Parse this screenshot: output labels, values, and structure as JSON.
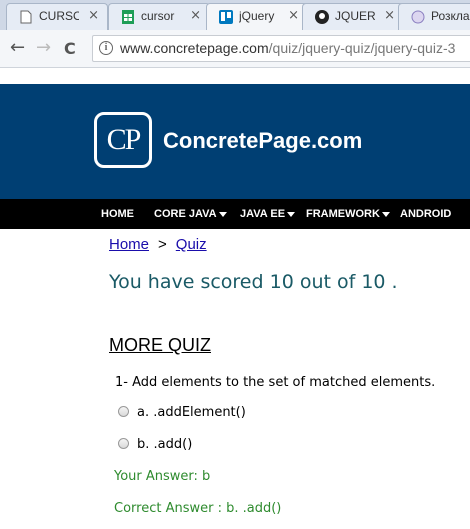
{
  "browser": {
    "tabs": [
      {
        "label": "CURSO",
        "icon": "document-icon",
        "close": "×"
      },
      {
        "label": "cursor",
        "icon": "sheets-icon",
        "close": "×"
      },
      {
        "label": "jQuery",
        "icon": "trello-icon",
        "close": "×"
      },
      {
        "label": "JQUER",
        "icon": "github-icon",
        "close": "×"
      },
      {
        "label": "Розкла",
        "icon": "tab-favicon-icon",
        "close": ""
      }
    ],
    "back": "←",
    "forward": "→",
    "reload": "C",
    "info": "i",
    "url_host": "www.concretepage.com",
    "url_path": "/quiz/jquery-quiz/jquery-quiz-3"
  },
  "site": {
    "logo_mark": "CP",
    "logo_text": "ConcretePage.com",
    "menu": [
      {
        "label": "HOME",
        "caret": false
      },
      {
        "label": "CORE JAVA",
        "caret": true
      },
      {
        "label": "JAVA EE",
        "caret": true
      },
      {
        "label": "FRAMEWORK",
        "caret": true
      },
      {
        "label": "ANDROID",
        "caret": false
      }
    ]
  },
  "content": {
    "breadcrumb_home": "Home",
    "breadcrumb_sep": ">",
    "breadcrumb_quiz": "Quiz",
    "score_text": "You have scored 10 out of 10 .",
    "more_quiz": "MORE QUIZ",
    "question": "1- Add elements to the set of matched elements.",
    "options": [
      "a. .addElement()",
      "b. .add()"
    ],
    "your_answer": "Your Answer: b",
    "correct_answer": "Correct Answer : b. .add()"
  }
}
